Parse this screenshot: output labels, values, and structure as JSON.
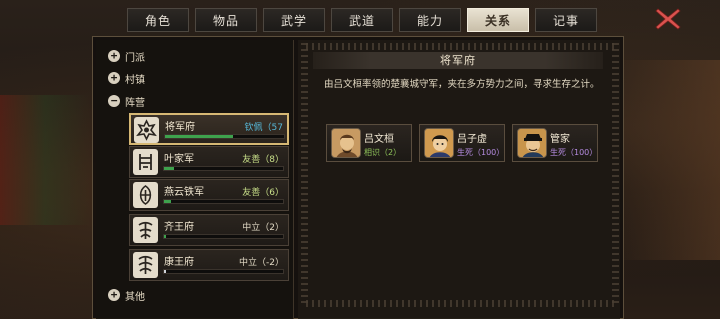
{
  "tabs": [
    {
      "label": "角色",
      "active": false
    },
    {
      "label": "物品",
      "active": false
    },
    {
      "label": "武学",
      "active": false
    },
    {
      "label": "武道",
      "active": false
    },
    {
      "label": "能力",
      "active": false
    },
    {
      "label": "关系",
      "active": true
    },
    {
      "label": "记事",
      "active": false
    }
  ],
  "tree": {
    "categories": [
      {
        "label": "门派",
        "icon": "+"
      },
      {
        "label": "村镇",
        "icon": "+"
      },
      {
        "label": "阵营",
        "icon": "−"
      },
      {
        "label": "其他",
        "icon": "+"
      }
    ],
    "factions": [
      {
        "name": "将军府",
        "status": "钦佩（57",
        "status_color": "#56b8d8",
        "progress": 0.57,
        "bar_color": "green",
        "emblem": "general-emblem",
        "selected": true
      },
      {
        "name": "叶家军",
        "status": "友善（8）",
        "status_color": "#c9e08a",
        "progress": 0.08,
        "bar_color": "green",
        "emblem": "yejia-emblem",
        "selected": false
      },
      {
        "name": "燕云铁军",
        "status": "友善（6）",
        "status_color": "#c9e08a",
        "progress": 0.06,
        "bar_color": "green",
        "emblem": "yanyun-emblem",
        "selected": false
      },
      {
        "name": "齐王府",
        "status": "中立（2）",
        "status_color": "#e0d8c4",
        "progress": 0.02,
        "bar_color": "green",
        "emblem": "qiwang-emblem",
        "selected": false
      },
      {
        "name": "康王府",
        "status": "中立（-2）",
        "status_color": "#e0d8c4",
        "progress": 0.02,
        "bar_color": "neutral",
        "emblem": "kangwang-emblem",
        "selected": false
      }
    ]
  },
  "detail": {
    "title": "将军府",
    "description": "由吕文桓率领的楚襄城守军，夹在多方势力之间，寻求生存之计。",
    "members": [
      {
        "name": "吕文桓",
        "relation": "相识（2）",
        "relation_color": "#8fc45a"
      },
      {
        "name": "吕子虚",
        "relation": "生死（100）",
        "relation_color": "#b48be0"
      },
      {
        "name": "管家",
        "relation": "生死（100）",
        "relation_color": "#b48be0"
      }
    ]
  },
  "colors": {
    "accent": "#d6b874",
    "close": "#d9534f",
    "tab_active_bg": "#e2dac8"
  }
}
